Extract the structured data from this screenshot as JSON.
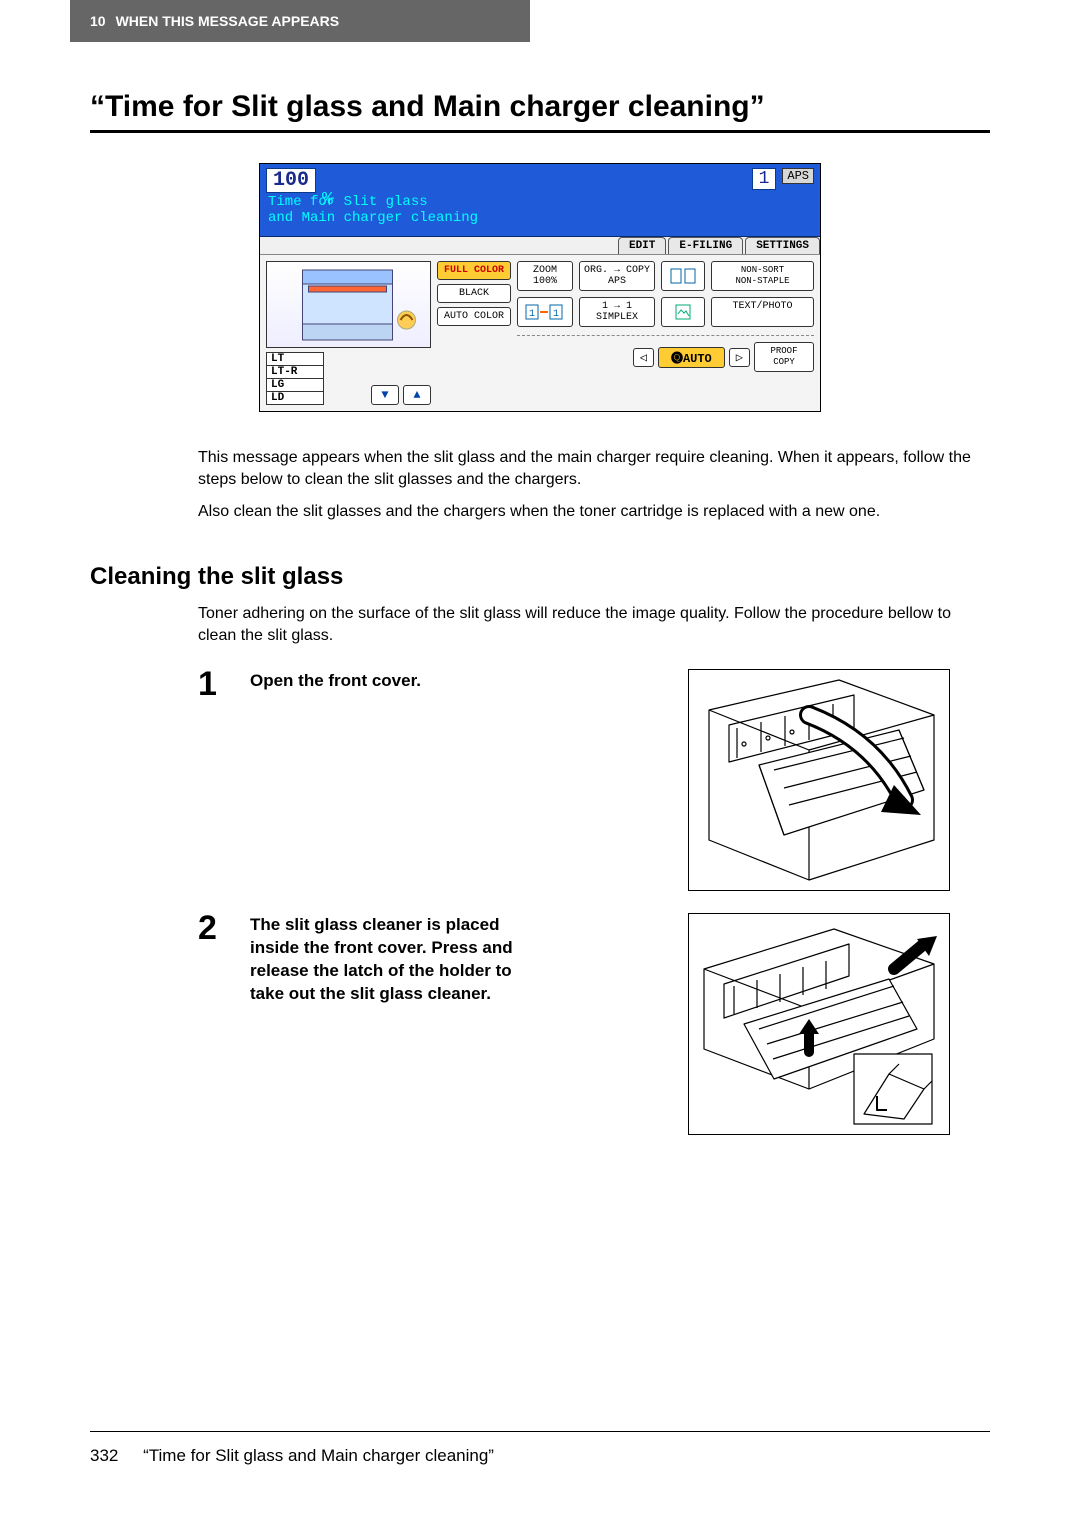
{
  "header": {
    "chapter_number": "10",
    "chapter_title": "WHEN THIS MESSAGE APPEARS"
  },
  "section_title": "“Time for Slit glass and Main charger cleaning”",
  "screen": {
    "zoom_value": "100",
    "percent": "%",
    "count_value": "1",
    "aps_label": "APS",
    "status_line1": "Time for Slit glass",
    "status_line2": "and Main charger cleaning",
    "tabs": {
      "edit": "EDIT",
      "efiling": "E-FILING",
      "settings": "SETTINGS"
    },
    "color_buttons": {
      "full": "FULL COLOR",
      "black": "BLACK",
      "auto": "AUTO COLOR"
    },
    "paper_sizes": [
      "LT",
      "LT-R",
      "LG",
      "LD"
    ],
    "cells": {
      "zoom": "ZOOM\n100%",
      "org_copy": "ORG. → COPY\nAPS",
      "non_sort": "NON-SORT\nNON-STAPLE",
      "simplex": "1 → 1\nSIMPLEX",
      "text_photo": "TEXT/PHOTO",
      "proof": "PROOF\nCOPY"
    },
    "auto_label": "AUTO"
  },
  "body_paragraphs": {
    "p1": "This message appears when the slit glass and the main charger require cleaning. When it appears, follow the steps below to clean the slit glasses and the chargers.",
    "p2": "Also clean the slit glasses and the chargers when the toner cartridge is replaced with a new one."
  },
  "subsection_title": "Cleaning the slit glass",
  "subsection_intro": "Toner adhering on the surface of the slit glass will reduce the image quality. Follow the procedure bellow to clean the slit glass.",
  "steps": [
    {
      "num": "1",
      "text": "Open the front cover."
    },
    {
      "num": "2",
      "text": "The slit glass cleaner is placed inside the front cover. Press and release the latch of the holder to take out the slit glass cleaner."
    }
  ],
  "footer": {
    "page_number": "332",
    "title": "“Time for Slit glass and Main charger cleaning”"
  }
}
